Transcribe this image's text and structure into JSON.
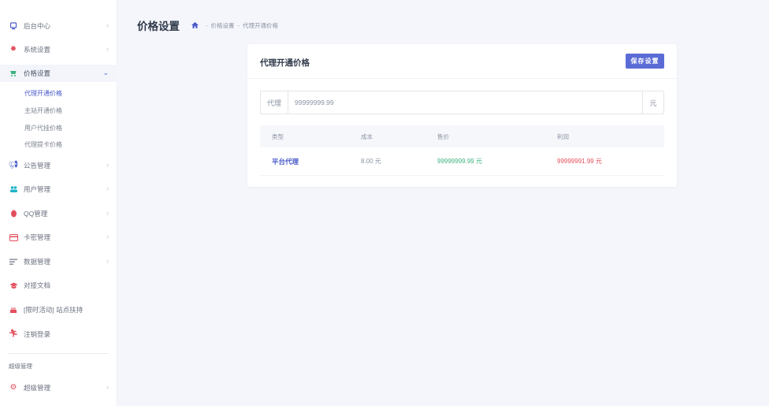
{
  "sidebar": {
    "items": [
      {
        "label": "后台中心",
        "icon": "monitor-icon",
        "color": "#4a5cc7"
      },
      {
        "label": "系统设置",
        "icon": "gear-icon",
        "color": "#e2505e"
      },
      {
        "label": "价格设置",
        "icon": "cart-icon",
        "color": "#3fb27f"
      },
      {
        "label": "公告管理",
        "icon": "megaphone-icon",
        "color": "#4a5cc7"
      },
      {
        "label": "用户管理",
        "icon": "users-icon",
        "color": "#1fb3c9"
      },
      {
        "label": "QQ管理",
        "icon": "qq-icon",
        "color": "#e2505e"
      },
      {
        "label": "卡密管理",
        "icon": "card-icon",
        "color": "#e2505e"
      },
      {
        "label": "数据管理",
        "icon": "list-icon",
        "color": "#6b7280"
      },
      {
        "label": "对接文档",
        "icon": "graduation-cap-icon",
        "color": "#e2505e"
      },
      {
        "label": "[限时活动] 站点扶持",
        "icon": "cake-icon",
        "color": "#e2505e"
      },
      {
        "label": "注销登录",
        "icon": "runner-icon",
        "color": "#e2505e"
      }
    ],
    "subitems": [
      {
        "label": "代理开通价格"
      },
      {
        "label": "主站开通价格"
      },
      {
        "label": "用户代挂价格"
      },
      {
        "label": "代理提卡价格"
      }
    ],
    "section_label": "超级管理",
    "super_item": {
      "label": "超级管理",
      "icon": "gears-icon",
      "color": "#e2505e"
    }
  },
  "header": {
    "title": "价格设置",
    "breadcrumb": [
      "价格设置",
      "代理开通价格"
    ]
  },
  "card": {
    "title": "代理开通价格",
    "save_label": "保存设置",
    "input": {
      "prefix": "代理",
      "value": "99999999.99",
      "suffix": "元"
    },
    "table": {
      "headers": [
        "类型",
        "成本",
        "售价",
        "利润"
      ],
      "rows": [
        {
          "type": "平台代理",
          "cost": "8.00 元",
          "price": "99999999.99 元",
          "profit": "99999991.99 元"
        }
      ]
    }
  },
  "colors": {
    "accent": "#5b6bd6",
    "success": "#3fb27f",
    "danger": "#e2505e"
  }
}
